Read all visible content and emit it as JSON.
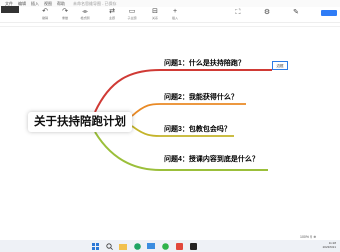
{
  "menu": {
    "items": [
      "文件",
      "编辑",
      "插入",
      "视图",
      "帮助"
    ],
    "doc_title": "未命名思维导图 - 已保存"
  },
  "toolbar": {
    "left_items": [
      {
        "icon": "↶",
        "label": "撤销"
      },
      {
        "icon": "↷",
        "label": "重做"
      },
      {
        "icon": "⌯",
        "label": "格式刷"
      },
      {
        "icon": "⇄",
        "label": "主题"
      },
      {
        "icon": "▭",
        "label": "子主题"
      },
      {
        "icon": "⊟",
        "label": "关系"
      },
      {
        "icon": "+",
        "label": "插入"
      }
    ],
    "right_items": [
      {
        "icon": "⛶",
        "label": ""
      },
      {
        "icon": "⚙",
        "label": ""
      },
      {
        "icon": "✎",
        "label": ""
      }
    ]
  },
  "mindmap": {
    "root": "关于扶持陪跑计划",
    "branches": [
      {
        "text": "问题1：什么是扶持陪跑？",
        "color": "#d03a35"
      },
      {
        "text": "问题2：我能获得什么？",
        "color": "#e98a26"
      },
      {
        "text": "问题3：包教包会吗？",
        "color": "#c4b42a"
      },
      {
        "text": "问题4：授课内容到底是什么？",
        "color": "#9bbf3a"
      }
    ],
    "tag_label": "边框"
  },
  "statusbar": {
    "zoom": "100%  ⚲  ⊕"
  },
  "taskbar": {
    "time": "11:28",
    "date": "2023/6/21"
  }
}
